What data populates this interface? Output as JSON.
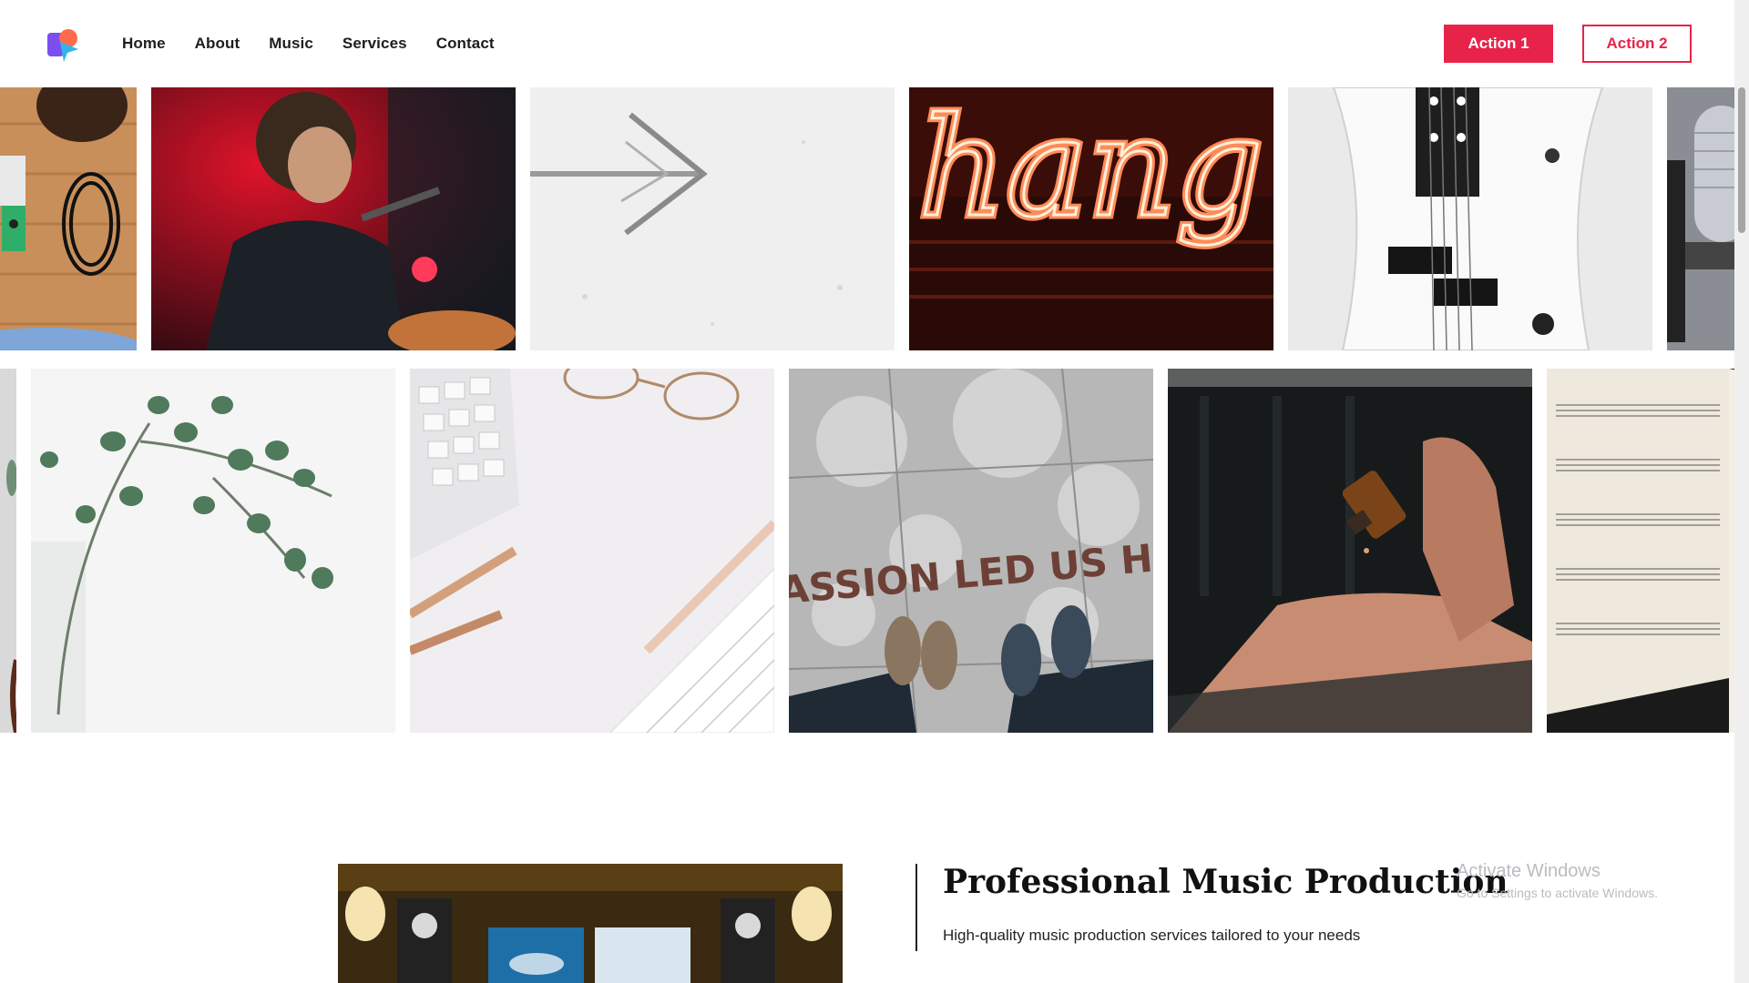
{
  "header": {
    "logo_icon": "brand-logo-icon",
    "nav": [
      {
        "label": "Home"
      },
      {
        "label": "About"
      },
      {
        "label": "Music"
      },
      {
        "label": "Services"
      },
      {
        "label": "Contact"
      }
    ],
    "action1_label": "Action 1",
    "action2_label": "Action 2"
  },
  "colors": {
    "accent": "#e8234a",
    "text": "#1d1d1d",
    "background": "#ffffff"
  },
  "gallery": {
    "row1": [
      {
        "icon": "guitar-pedals-photo"
      },
      {
        "icon": "singer-guitarist-photo"
      },
      {
        "icon": "arrow-sketch-photo"
      },
      {
        "icon": "neon-sign-photo",
        "text": "hang"
      },
      {
        "icon": "bass-guitar-photo"
      },
      {
        "icon": "microphone-photo"
      }
    ],
    "row2": [
      {
        "icon": "plant-edge-photo"
      },
      {
        "icon": "eucalyptus-vase-photo"
      },
      {
        "icon": "desk-keyboard-pen-photo"
      },
      {
        "icon": "sidewalk-text-photo",
        "text": "ASSION LED US HE"
      },
      {
        "icon": "hands-bottle-photo"
      },
      {
        "icon": "sheet-music-piano-photo"
      }
    ]
  },
  "feature": {
    "image_icon": "studio-monitors-photo",
    "title": "Professional Music Production",
    "subtitle": "High-quality music production services tailored to your needs"
  },
  "watermark": {
    "title": "Activate Windows",
    "subtitle": "Go to Settings to activate Windows."
  }
}
